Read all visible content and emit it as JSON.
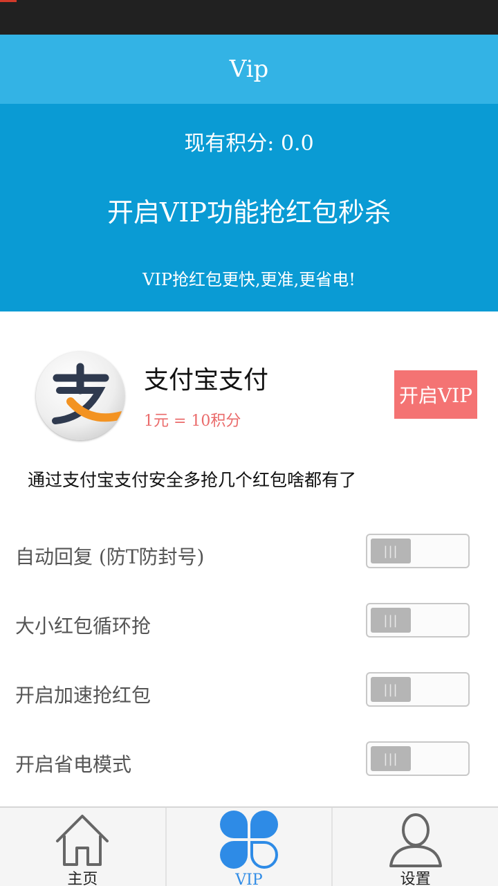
{
  "app": {
    "title": "Vip",
    "colors": {
      "title_bar": "#33b3e5",
      "banner": "#0a9bd4",
      "accent_red": "#f47373",
      "active_tab": "#2e8be6"
    }
  },
  "banner": {
    "points": "现有积分: 0.0",
    "headline": "开启VIP功能抢红包秒杀",
    "tagline": "VIP抢红包更快,更准,更省电!"
  },
  "payment": {
    "logo_icon": "alipay-logo-icon",
    "title": "支付宝支付",
    "rate": "1元 = 10积分",
    "button_label": "开启VIP",
    "description": "通过支付宝支付安全多抢几个红包啥都有了"
  },
  "settings": [
    {
      "label": "自动回复 (防T防封号)",
      "enabled": false
    },
    {
      "label": "大小红包循环抢",
      "enabled": false
    },
    {
      "label": "开启加速抢红包",
      "enabled": false
    },
    {
      "label": "开启省电模式",
      "enabled": false
    }
  ],
  "toggle_grip": "|||",
  "nav": {
    "tabs": [
      {
        "label": "主页",
        "icon": "home-icon",
        "active": false
      },
      {
        "label": "VIP",
        "icon": "clover-icon",
        "active": true
      },
      {
        "label": "设置",
        "icon": "user-icon",
        "active": false
      }
    ]
  }
}
